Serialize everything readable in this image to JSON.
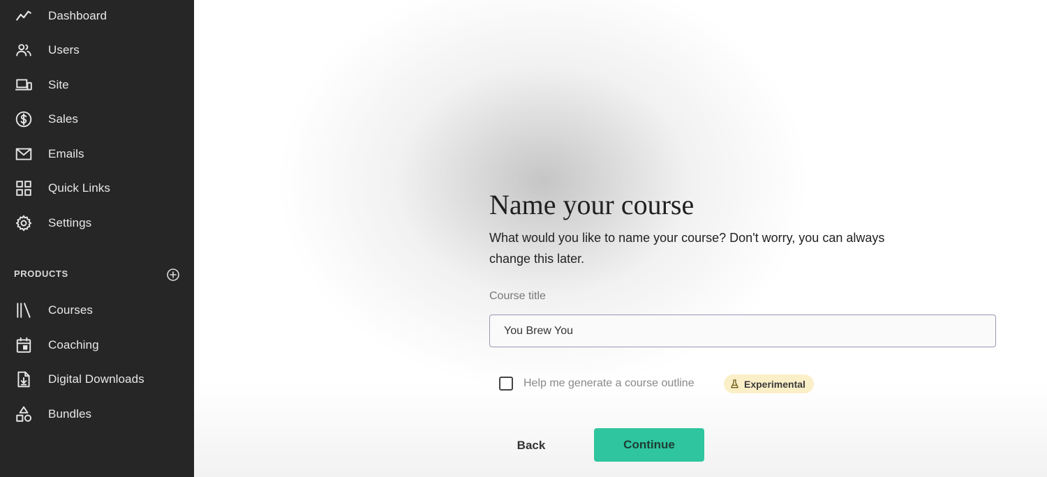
{
  "sidebar": {
    "items": [
      {
        "label": "Dashboard",
        "icon": "trend-line-icon"
      },
      {
        "label": "Users",
        "icon": "users-icon"
      },
      {
        "label": "Site",
        "icon": "devices-icon"
      },
      {
        "label": "Sales",
        "icon": "dollar-circle-icon"
      },
      {
        "label": "Emails",
        "icon": "envelope-icon"
      },
      {
        "label": "Quick Links",
        "icon": "grid-icon"
      },
      {
        "label": "Settings",
        "icon": "gear-icon"
      }
    ],
    "products_header": "PRODUCTS",
    "products": [
      {
        "label": "Courses",
        "icon": "library-icon"
      },
      {
        "label": "Coaching",
        "icon": "calendar-icon"
      },
      {
        "label": "Digital Downloads",
        "icon": "download-file-icon"
      },
      {
        "label": "Bundles",
        "icon": "shapes-icon"
      }
    ]
  },
  "main": {
    "title": "Name your course",
    "description": "What would you like to name your course? Don't worry, you can always change this later.",
    "field_label": "Course title",
    "course_title_value": "You Brew You",
    "checkbox_label": "Help me generate a course outline",
    "badge_label": "Experimental",
    "back_label": "Back",
    "continue_label": "Continue"
  },
  "colors": {
    "sidebar_bg": "#262626",
    "accent": "#2fc59e",
    "badge_bg": "#fbefc8",
    "input_border": "#9a96b4"
  }
}
